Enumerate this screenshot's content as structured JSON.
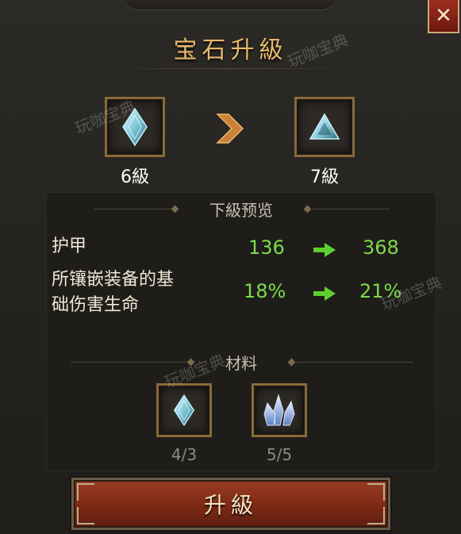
{
  "dialog": {
    "title": "宝石升級",
    "close_label": "✕"
  },
  "current_gem": {
    "level_label": "6級",
    "icon": "diamond-crystal-icon"
  },
  "next_gem": {
    "level_label": "7級",
    "icon": "triangle-crystal-icon"
  },
  "preview": {
    "section_title": "下級预览",
    "stats": [
      {
        "label": "护甲",
        "from": "136",
        "to": "368"
      },
      {
        "label_line1": "所镶嵌装备的基",
        "label_line2": "础伤害生命",
        "from": "18%",
        "to": "21%"
      }
    ]
  },
  "materials": {
    "section_title": "材料",
    "items": [
      {
        "icon": "diamond-crystal-icon",
        "count": "4/3"
      },
      {
        "icon": "crystal-cluster-icon",
        "count": "5/5"
      }
    ]
  },
  "upgrade_button": {
    "label": "升級"
  },
  "watermark": {
    "text": "玩咖宝典"
  },
  "colors": {
    "title": "#e8b86a",
    "stat_value": "#7ddc4a",
    "button": "#8a3219",
    "frame_gold": "#8a6a3a"
  }
}
